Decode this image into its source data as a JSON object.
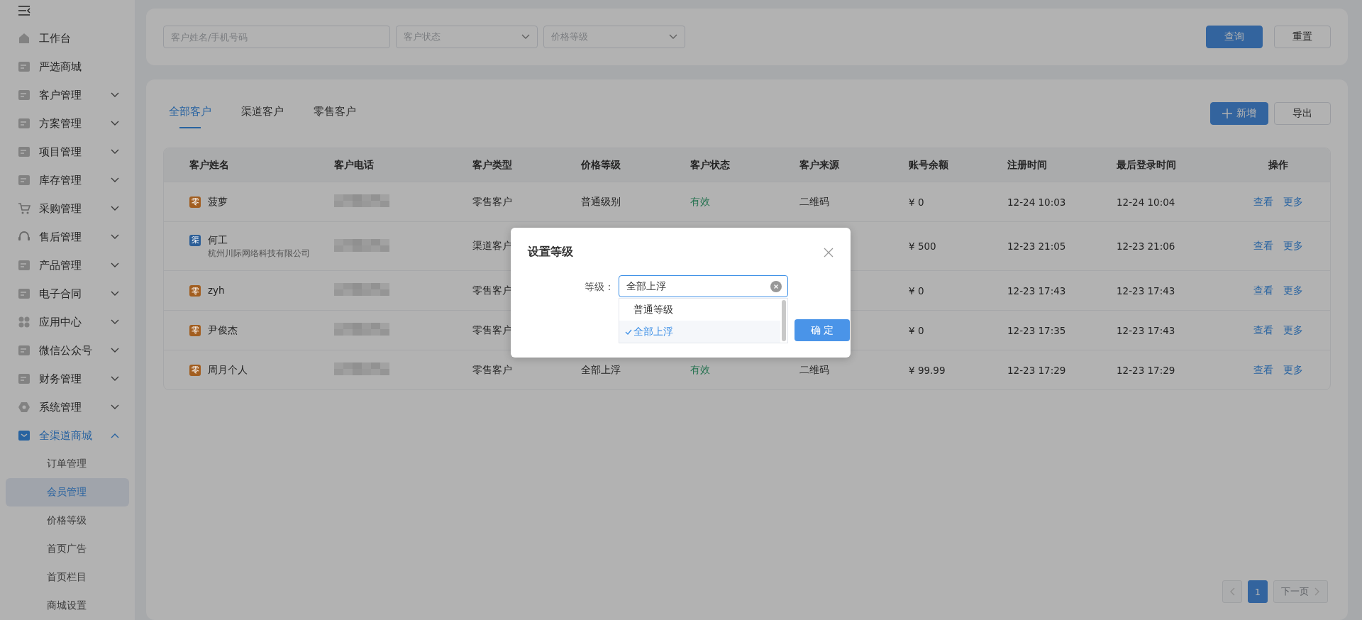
{
  "sidebar": {
    "items": [
      {
        "label": "工作台",
        "selected": false
      },
      {
        "label": "严选商城",
        "selected": false
      },
      {
        "label": "客户管理",
        "selected": false,
        "expanded": false
      },
      {
        "label": "方案管理",
        "selected": false,
        "expanded": false
      },
      {
        "label": "项目管理",
        "selected": false,
        "expanded": false
      },
      {
        "label": "库存管理",
        "selected": false,
        "expanded": false
      },
      {
        "label": "采购管理",
        "selected": false,
        "expanded": false
      },
      {
        "label": "售后管理",
        "selected": false,
        "expanded": false
      },
      {
        "label": "产品管理",
        "selected": false,
        "expanded": false
      },
      {
        "label": "电子合同",
        "selected": false,
        "expanded": false
      },
      {
        "label": "应用中心",
        "selected": false,
        "expanded": false
      },
      {
        "label": "微信公众号",
        "selected": false,
        "expanded": false
      },
      {
        "label": "财务管理",
        "selected": false,
        "expanded": false
      },
      {
        "label": "系统管理",
        "selected": false,
        "expanded": false
      },
      {
        "label": "全渠道商城",
        "selected": true,
        "expanded": true,
        "children": [
          {
            "label": "订单管理",
            "selected": false
          },
          {
            "label": "会员管理",
            "selected": true
          },
          {
            "label": "价格等级",
            "selected": false
          },
          {
            "label": "首页广告",
            "selected": false
          },
          {
            "label": "首页栏目",
            "selected": false
          },
          {
            "label": "商城设置",
            "selected": false
          }
        ]
      }
    ]
  },
  "filters": {
    "search": {
      "placeholder": "客户姓名/手机号码"
    },
    "selects": [
      {
        "placeholder": "客户状态"
      },
      {
        "placeholder": "价格等级"
      }
    ],
    "buttons": [
      {
        "label": "查询",
        "kind": "primary"
      },
      {
        "label": "重置",
        "kind": "default"
      }
    ]
  },
  "tabs": [
    {
      "label": "全部客户",
      "selected": true
    },
    {
      "label": "渠道客户",
      "selected": false
    },
    {
      "label": "零售客户",
      "selected": false
    }
  ],
  "actions": [
    {
      "label": "新增",
      "kind": "primary"
    },
    {
      "label": "导出",
      "kind": "default"
    }
  ],
  "table": {
    "columns": [
      "客户姓名",
      "客户电话",
      "客户类型",
      "价格等级",
      "客户状态",
      "客户来源",
      "账号余额",
      "注册时间",
      "最后登录时间",
      "操作"
    ],
    "rows": [
      {
        "badge": "零",
        "color": "#a25e20",
        "name": "菠萝",
        "type": "零售客户",
        "price_level": "普通级别",
        "status": "有效",
        "source": "二维码",
        "balance": "¥ 0",
        "registered": "12-24 10:03",
        "last_login": "12-24 10:04",
        "links": [
          "查看",
          "更多"
        ]
      },
      {
        "badge": "渠",
        "color": "#2c5e97",
        "name": "何工",
        "company": "杭州川际网络科技有限公司",
        "type": "渠道客户",
        "balance": "¥ 500",
        "registered": "12-23 21:05",
        "last_login": "12-23 21:06",
        "links": [
          "查看",
          "更多"
        ]
      },
      {
        "badge": "零",
        "color": "#a25e20",
        "name": "zyh",
        "type": "零售客户",
        "balance": "¥ 0",
        "registered": "12-23 17:43",
        "last_login": "12-23 17:43",
        "links": [
          "查看",
          "更多"
        ]
      },
      {
        "badge": "零",
        "color": "#a25e20",
        "name": "尹俊杰",
        "type": "零售客户",
        "balance": "¥ 0",
        "registered": "12-23 17:35",
        "last_login": "12-23 17:43",
        "links": [
          "查看",
          "更多"
        ]
      },
      {
        "badge": "零",
        "color": "#a25e20",
        "name": "周月个人",
        "type": "零售客户",
        "price_level": "全部上浮",
        "status": "有效",
        "source": "二维码",
        "balance": "¥ 99.99",
        "registered": "12-23 17:29",
        "last_login": "12-23 17:29",
        "links": [
          "查看",
          "更多"
        ]
      }
    ]
  },
  "pagination": {
    "prev_disabled": true,
    "pages": [
      {
        "label": "1",
        "selected": true
      }
    ],
    "next": {
      "label": "下一页",
      "disabled": true
    }
  },
  "dialog": {
    "title": "设置等级",
    "field_label": "等级：",
    "value": "全部上浮",
    "options": [
      {
        "label": "普通等级",
        "selected": false
      },
      {
        "label": "全部上浮",
        "selected": true
      }
    ],
    "confirm": "确 定"
  }
}
